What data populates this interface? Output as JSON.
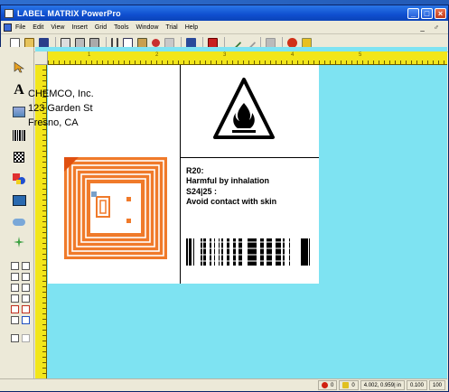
{
  "window": {
    "title": "LABEL MATRIX PowerPro",
    "controls": {
      "minimize": "_",
      "maximize": "□",
      "close": "×"
    }
  },
  "menu": {
    "items": [
      "File",
      "Edit",
      "View",
      "Insert",
      "Grid",
      "Tools",
      "Window",
      "Trial",
      "Help"
    ],
    "mdi_controls": "_ ♂"
  },
  "toolbar": {
    "buttons": [
      "new-icon",
      "open-icon",
      "save-icon",
      "print-preview-icon",
      "print-icon",
      "print-setup-icon",
      "cut-icon",
      "copy-icon",
      "paste-icon",
      "undo-icon",
      "redo-icon",
      "database-icon",
      "trial-icon",
      "zoom-in-icon",
      "zoom-out-icon",
      "grid-icon",
      "bug-icon",
      "settings-icon"
    ]
  },
  "left_toolbar": {
    "tools": [
      "pointer-tool",
      "text-tool",
      "graphic-tool",
      "barcode-tool",
      "matrix-barcode-tool",
      "color-shapes-tool",
      "image-tool",
      "rfid-tool",
      "sparkle-tool"
    ]
  },
  "ruler": {
    "marks": [
      "1",
      "2",
      "3",
      "4",
      "5"
    ]
  },
  "label": {
    "company": [
      "CHEMCO, Inc.",
      "123 Garden St",
      "Fresno, CA"
    ],
    "warnings": [
      "R20:",
      "Harmful by inhalation",
      "S24|25 :",
      "Avoid contact with skin"
    ]
  },
  "status": {
    "count_red": "0",
    "count_yellow": "0",
    "coords": "4.002, 0.959| in",
    "zoom": "0.100",
    "zoom_pct": "100"
  },
  "colors": {
    "canvas": "#7ee3f2",
    "ruler": "#f2e61a",
    "rfid_orange": "#f07a2a"
  }
}
